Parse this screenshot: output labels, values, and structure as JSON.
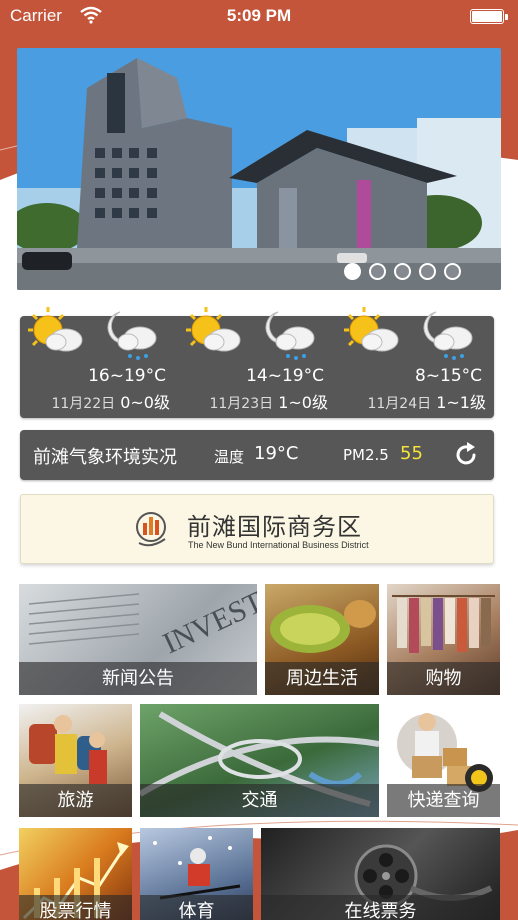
{
  "status_bar": {
    "carrier": "Carrier",
    "time": "5:09 PM"
  },
  "banner": {
    "page_count": 5,
    "active_page": 1
  },
  "weather": {
    "days": [
      {
        "temp": "16~19°C",
        "date": "11月22日",
        "wind": "0~0级",
        "icons": [
          "sunny-cloudy-icon",
          "night-rain-icon"
        ]
      },
      {
        "temp": "14~19°C",
        "date": "11月23日",
        "wind": "1~0级",
        "icons": [
          "sunny-cloudy-icon",
          "night-rain-icon"
        ]
      },
      {
        "temp": "8~15°C",
        "date": "11月24日",
        "wind": "1~1级",
        "icons": [
          "sunny-cloudy-icon",
          "night-rain-icon"
        ]
      }
    ]
  },
  "live": {
    "title": "前滩气象环境实况",
    "temp_label": "温度",
    "temp_value": "19°C",
    "pm_label": "PM2.5",
    "pm_value": "55",
    "pm_color": "#f5e23a"
  },
  "district": {
    "name": "前滩国际商务区",
    "name_en": "The New Bund International Business District"
  },
  "tiles": {
    "news": "新闻公告",
    "life": "周边生活",
    "shop": "购物",
    "travel": "旅游",
    "traffic": "交通",
    "express": "快递查询",
    "stock": "股票行情",
    "sport": "体育",
    "ticket": "在线票务"
  },
  "colors": {
    "accent": "#c4553a",
    "panel": "#575757"
  }
}
